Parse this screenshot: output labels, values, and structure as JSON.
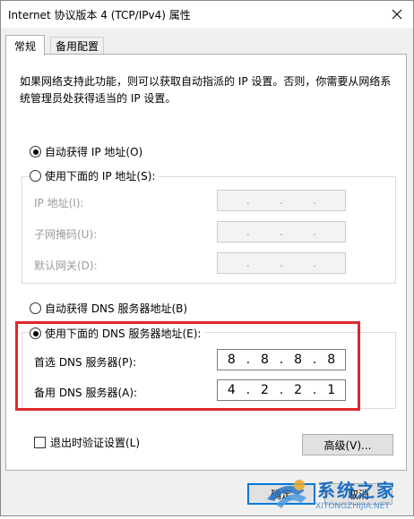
{
  "window": {
    "title": "Internet 协议版本 4 (TCP/IPv4) 属性",
    "close_glyph": "✕"
  },
  "tabs": [
    {
      "label": "常规",
      "active": true
    },
    {
      "label": "备用配置",
      "active": false
    }
  ],
  "description": "如果网络支持此功能，则可以获取自动指派的 IP 设置。否则，你需要从网络系统管理员处获得适当的 IP 设置。",
  "ip_section": {
    "auto_label": "自动获得 IP 地址(O)",
    "manual_label": "使用下面的 IP 地址(S):",
    "auto_selected": true,
    "fields": [
      {
        "label": "IP 地址(I):",
        "value": [
          "",
          "",
          "",
          ""
        ]
      },
      {
        "label": "子网掩码(U):",
        "value": [
          "",
          "",
          "",
          ""
        ]
      },
      {
        "label": "默认网关(D):",
        "value": [
          "",
          "",
          "",
          ""
        ]
      }
    ]
  },
  "dns_section": {
    "auto_label": "自动获得 DNS 服务器地址(B)",
    "manual_label": "使用下面的 DNS 服务器地址(E):",
    "manual_selected": true,
    "preferred": {
      "label": "首选 DNS 服务器(P):",
      "octets": [
        "8",
        "8",
        "8",
        "8"
      ]
    },
    "alternate": {
      "label": "备用 DNS 服务器(A):",
      "octets": [
        "4",
        "2",
        "2",
        "1"
      ]
    }
  },
  "validate_on_exit": {
    "label": "退出时验证设置(L)",
    "checked": false
  },
  "buttons": {
    "advanced": "高级(V)...",
    "ok": "确定",
    "cancel": "取消"
  },
  "watermark": {
    "text": "系统之家",
    "url_text": "XITONGZHIJIA.NET"
  },
  "colors": {
    "highlight_border": "#e0262c",
    "focus_border": "#0078d7"
  }
}
